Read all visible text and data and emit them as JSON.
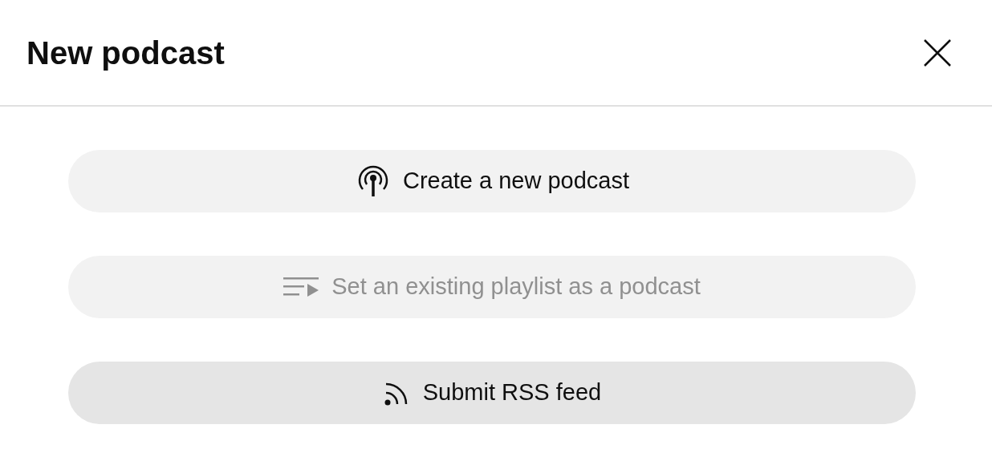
{
  "dialog": {
    "title": "New podcast"
  },
  "options": [
    {
      "kind": "podcast",
      "label": "Create a new podcast",
      "disabled": false,
      "highlighted": false
    },
    {
      "kind": "playlist",
      "label": "Set an existing playlist as a podcast",
      "disabled": true,
      "highlighted": false
    },
    {
      "kind": "rss",
      "label": "Submit RSS feed",
      "disabled": false,
      "highlighted": true
    }
  ]
}
